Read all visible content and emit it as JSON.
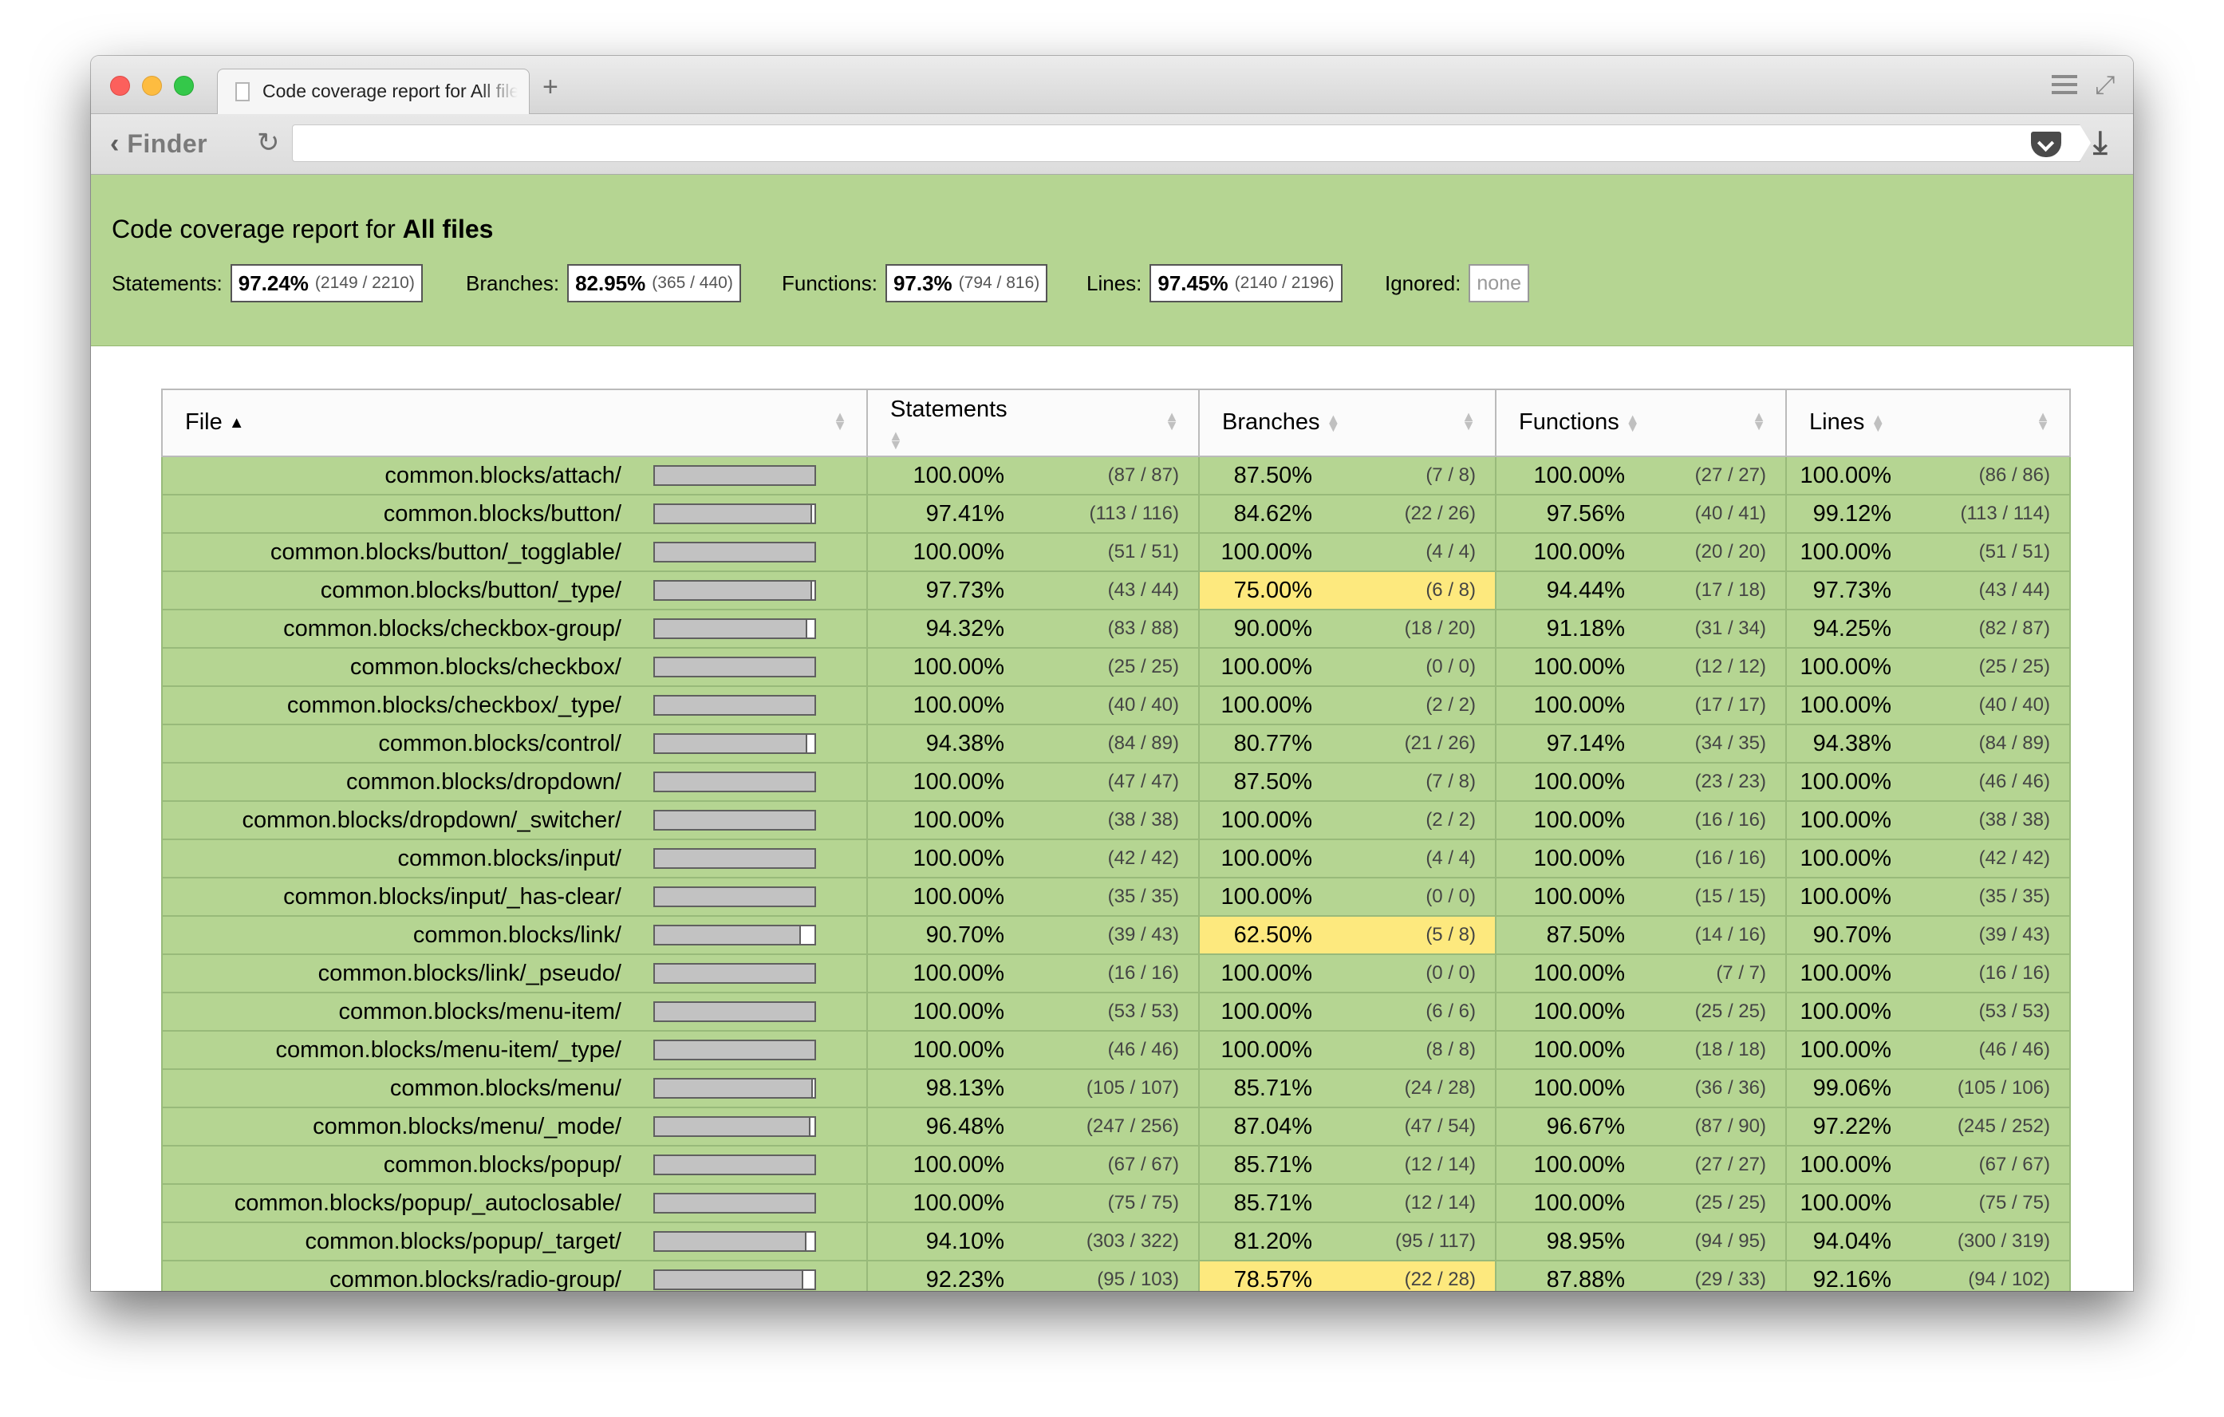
{
  "browser": {
    "tab_title": "Code coverage report for All files",
    "new_tab_label": "+",
    "back_label": "Finder",
    "url": ""
  },
  "report": {
    "title_prefix": "Code coverage report for ",
    "title_scope": "All files",
    "summary": [
      {
        "label": "Statements:",
        "pct": "97.24%",
        "frac": "(2149 / 2210)"
      },
      {
        "label": "Branches:",
        "pct": "82.95%",
        "frac": "(365 / 440)"
      },
      {
        "label": "Functions:",
        "pct": "97.3%",
        "frac": "(794 / 816)"
      },
      {
        "label": "Lines:",
        "pct": "97.45%",
        "frac": "(2140 / 2196)"
      }
    ],
    "ignored_label": "Ignored:",
    "ignored_value": "none"
  },
  "table": {
    "headers": {
      "file": "File",
      "statements": "Statements",
      "branches": "Branches",
      "functions": "Functions",
      "lines": "Lines"
    },
    "rows": [
      {
        "file": "common.blocks/attach/",
        "bar": 1.0,
        "stmt_pct": "100.00%",
        "stmt_frac": "(87 / 87)",
        "br_pct": "87.50%",
        "br_frac": "(7 / 8)",
        "br_low": false,
        "fn_pct": "100.00%",
        "fn_frac": "(27 / 27)",
        "ln_pct": "100.00%",
        "ln_frac": "(86 / 86)"
      },
      {
        "file": "common.blocks/button/",
        "bar": 0.9741,
        "stmt_pct": "97.41%",
        "stmt_frac": "(113 / 116)",
        "br_pct": "84.62%",
        "br_frac": "(22 / 26)",
        "br_low": false,
        "fn_pct": "97.56%",
        "fn_frac": "(40 / 41)",
        "ln_pct": "99.12%",
        "ln_frac": "(113 / 114)"
      },
      {
        "file": "common.blocks/button/_togglable/",
        "bar": 1.0,
        "stmt_pct": "100.00%",
        "stmt_frac": "(51 / 51)",
        "br_pct": "100.00%",
        "br_frac": "(4 / 4)",
        "br_low": false,
        "fn_pct": "100.00%",
        "fn_frac": "(20 / 20)",
        "ln_pct": "100.00%",
        "ln_frac": "(51 / 51)"
      },
      {
        "file": "common.blocks/button/_type/",
        "bar": 0.9773,
        "stmt_pct": "97.73%",
        "stmt_frac": "(43 / 44)",
        "br_pct": "75.00%",
        "br_frac": "(6 / 8)",
        "br_low": true,
        "fn_pct": "94.44%",
        "fn_frac": "(17 / 18)",
        "ln_pct": "97.73%",
        "ln_frac": "(43 / 44)"
      },
      {
        "file": "common.blocks/checkbox-group/",
        "bar": 0.9432,
        "stmt_pct": "94.32%",
        "stmt_frac": "(83 / 88)",
        "br_pct": "90.00%",
        "br_frac": "(18 / 20)",
        "br_low": false,
        "fn_pct": "91.18%",
        "fn_frac": "(31 / 34)",
        "ln_pct": "94.25%",
        "ln_frac": "(82 / 87)"
      },
      {
        "file": "common.blocks/checkbox/",
        "bar": 1.0,
        "stmt_pct": "100.00%",
        "stmt_frac": "(25 / 25)",
        "br_pct": "100.00%",
        "br_frac": "(0 / 0)",
        "br_low": false,
        "fn_pct": "100.00%",
        "fn_frac": "(12 / 12)",
        "ln_pct": "100.00%",
        "ln_frac": "(25 / 25)"
      },
      {
        "file": "common.blocks/checkbox/_type/",
        "bar": 1.0,
        "stmt_pct": "100.00%",
        "stmt_frac": "(40 / 40)",
        "br_pct": "100.00%",
        "br_frac": "(2 / 2)",
        "br_low": false,
        "fn_pct": "100.00%",
        "fn_frac": "(17 / 17)",
        "ln_pct": "100.00%",
        "ln_frac": "(40 / 40)"
      },
      {
        "file": "common.blocks/control/",
        "bar": 0.9438,
        "stmt_pct": "94.38%",
        "stmt_frac": "(84 / 89)",
        "br_pct": "80.77%",
        "br_frac": "(21 / 26)",
        "br_low": false,
        "fn_pct": "97.14%",
        "fn_frac": "(34 / 35)",
        "ln_pct": "94.38%",
        "ln_frac": "(84 / 89)"
      },
      {
        "file": "common.blocks/dropdown/",
        "bar": 1.0,
        "stmt_pct": "100.00%",
        "stmt_frac": "(47 / 47)",
        "br_pct": "87.50%",
        "br_frac": "(7 / 8)",
        "br_low": false,
        "fn_pct": "100.00%",
        "fn_frac": "(23 / 23)",
        "ln_pct": "100.00%",
        "ln_frac": "(46 / 46)"
      },
      {
        "file": "common.blocks/dropdown/_switcher/",
        "bar": 1.0,
        "stmt_pct": "100.00%",
        "stmt_frac": "(38 / 38)",
        "br_pct": "100.00%",
        "br_frac": "(2 / 2)",
        "br_low": false,
        "fn_pct": "100.00%",
        "fn_frac": "(16 / 16)",
        "ln_pct": "100.00%",
        "ln_frac": "(38 / 38)"
      },
      {
        "file": "common.blocks/input/",
        "bar": 1.0,
        "stmt_pct": "100.00%",
        "stmt_frac": "(42 / 42)",
        "br_pct": "100.00%",
        "br_frac": "(4 / 4)",
        "br_low": false,
        "fn_pct": "100.00%",
        "fn_frac": "(16 / 16)",
        "ln_pct": "100.00%",
        "ln_frac": "(42 / 42)"
      },
      {
        "file": "common.blocks/input/_has-clear/",
        "bar": 1.0,
        "stmt_pct": "100.00%",
        "stmt_frac": "(35 / 35)",
        "br_pct": "100.00%",
        "br_frac": "(0 / 0)",
        "br_low": false,
        "fn_pct": "100.00%",
        "fn_frac": "(15 / 15)",
        "ln_pct": "100.00%",
        "ln_frac": "(35 / 35)"
      },
      {
        "file": "common.blocks/link/",
        "bar": 0.907,
        "stmt_pct": "90.70%",
        "stmt_frac": "(39 / 43)",
        "br_pct": "62.50%",
        "br_frac": "(5 / 8)",
        "br_low": true,
        "fn_pct": "87.50%",
        "fn_frac": "(14 / 16)",
        "ln_pct": "90.70%",
        "ln_frac": "(39 / 43)"
      },
      {
        "file": "common.blocks/link/_pseudo/",
        "bar": 1.0,
        "stmt_pct": "100.00%",
        "stmt_frac": "(16 / 16)",
        "br_pct": "100.00%",
        "br_frac": "(0 / 0)",
        "br_low": false,
        "fn_pct": "100.00%",
        "fn_frac": "(7 / 7)",
        "ln_pct": "100.00%",
        "ln_frac": "(16 / 16)"
      },
      {
        "file": "common.blocks/menu-item/",
        "bar": 1.0,
        "stmt_pct": "100.00%",
        "stmt_frac": "(53 / 53)",
        "br_pct": "100.00%",
        "br_frac": "(6 / 6)",
        "br_low": false,
        "fn_pct": "100.00%",
        "fn_frac": "(25 / 25)",
        "ln_pct": "100.00%",
        "ln_frac": "(53 / 53)"
      },
      {
        "file": "common.blocks/menu-item/_type/",
        "bar": 1.0,
        "stmt_pct": "100.00%",
        "stmt_frac": "(46 / 46)",
        "br_pct": "100.00%",
        "br_frac": "(8 / 8)",
        "br_low": false,
        "fn_pct": "100.00%",
        "fn_frac": "(18 / 18)",
        "ln_pct": "100.00%",
        "ln_frac": "(46 / 46)"
      },
      {
        "file": "common.blocks/menu/",
        "bar": 0.9813,
        "stmt_pct": "98.13%",
        "stmt_frac": "(105 / 107)",
        "br_pct": "85.71%",
        "br_frac": "(24 / 28)",
        "br_low": false,
        "fn_pct": "100.00%",
        "fn_frac": "(36 / 36)",
        "ln_pct": "99.06%",
        "ln_frac": "(105 / 106)"
      },
      {
        "file": "common.blocks/menu/_mode/",
        "bar": 0.9648,
        "stmt_pct": "96.48%",
        "stmt_frac": "(247 / 256)",
        "br_pct": "87.04%",
        "br_frac": "(47 / 54)",
        "br_low": false,
        "fn_pct": "96.67%",
        "fn_frac": "(87 / 90)",
        "ln_pct": "97.22%",
        "ln_frac": "(245 / 252)"
      },
      {
        "file": "common.blocks/popup/",
        "bar": 1.0,
        "stmt_pct": "100.00%",
        "stmt_frac": "(67 / 67)",
        "br_pct": "85.71%",
        "br_frac": "(12 / 14)",
        "br_low": false,
        "fn_pct": "100.00%",
        "fn_frac": "(27 / 27)",
        "ln_pct": "100.00%",
        "ln_frac": "(67 / 67)"
      },
      {
        "file": "common.blocks/popup/_autoclosable/",
        "bar": 1.0,
        "stmt_pct": "100.00%",
        "stmt_frac": "(75 / 75)",
        "br_pct": "85.71%",
        "br_frac": "(12 / 14)",
        "br_low": false,
        "fn_pct": "100.00%",
        "fn_frac": "(25 / 25)",
        "ln_pct": "100.00%",
        "ln_frac": "(75 / 75)"
      },
      {
        "file": "common.blocks/popup/_target/",
        "bar": 0.941,
        "stmt_pct": "94.10%",
        "stmt_frac": "(303 / 322)",
        "br_pct": "81.20%",
        "br_frac": "(95 / 117)",
        "br_low": false,
        "fn_pct": "98.95%",
        "fn_frac": "(94 / 95)",
        "ln_pct": "94.04%",
        "ln_frac": "(300 / 319)"
      },
      {
        "file": "common.blocks/radio-group/",
        "bar": 0.9223,
        "stmt_pct": "92.23%",
        "stmt_frac": "(95 / 103)",
        "br_pct": "78.57%",
        "br_frac": "(22 / 28)",
        "br_low": true,
        "fn_pct": "87.88%",
        "fn_frac": "(29 / 33)",
        "ln_pct": "92.16%",
        "ln_frac": "(94 / 102)"
      }
    ]
  }
}
